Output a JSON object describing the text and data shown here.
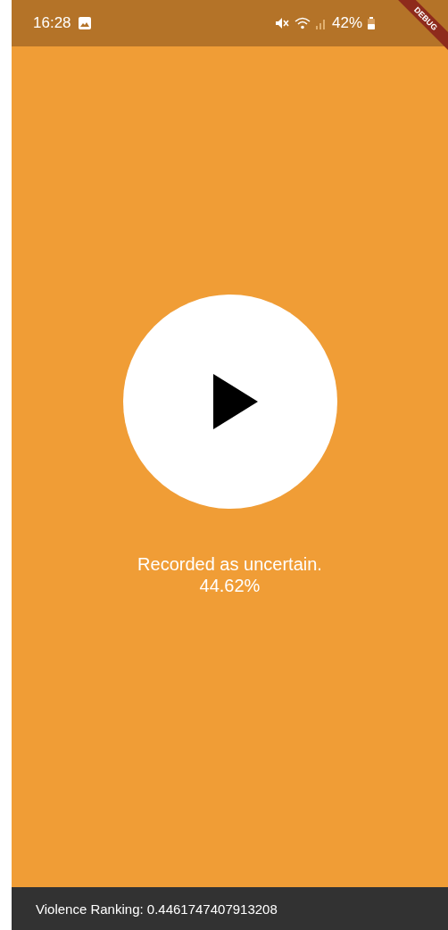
{
  "status_bar": {
    "time": "16:28",
    "battery": "42%"
  },
  "debug_banner": {
    "label": "DEBUG"
  },
  "player": {
    "playing": false
  },
  "result": {
    "lines": [
      "Recorded as uncertain.",
      "44.62%"
    ]
  },
  "snackbar": {
    "message": "Violence Ranking: 0.4461747407913208"
  }
}
